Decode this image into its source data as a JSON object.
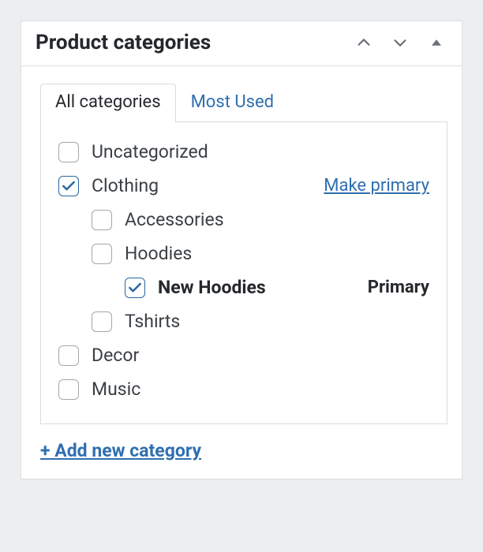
{
  "panel": {
    "title": "Product categories"
  },
  "tabs": {
    "all": "All categories",
    "most_used": "Most Used"
  },
  "categories": [
    {
      "label": "Uncategorized",
      "checked": false
    },
    {
      "label": "Clothing",
      "checked": true,
      "right": "Make primary",
      "right_kind": "link",
      "children": [
        {
          "label": "Accessories",
          "checked": false
        },
        {
          "label": "Hoodies",
          "checked": false,
          "children": [
            {
              "label": "New Hoodies",
              "checked": true,
              "bold": true,
              "right": "Primary",
              "right_kind": "primary"
            }
          ]
        },
        {
          "label": "Tshirts",
          "checked": false
        }
      ]
    },
    {
      "label": "Decor",
      "checked": false
    },
    {
      "label": "Music",
      "checked": false
    }
  ],
  "actions": {
    "add_new": "+ Add new category"
  }
}
